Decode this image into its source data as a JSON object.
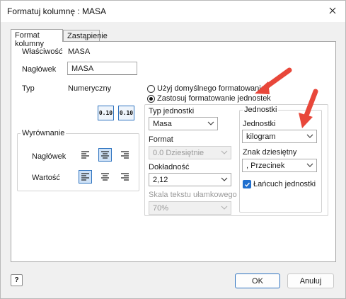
{
  "window": {
    "title": "Formatuj kolumnę : MASA"
  },
  "tabs": [
    {
      "label": "Format kolumny",
      "active": true
    },
    {
      "label": "Zastąpienie",
      "active": false
    }
  ],
  "properties": {
    "property_label": "Właściwość",
    "property_value": "MASA",
    "header_label": "Nagłówek",
    "header_value": "MASA",
    "type_label": "Typ",
    "type_value": "Numeryczny"
  },
  "format_buttons": [
    {
      "text": "0.10"
    },
    {
      "text": "0.10"
    }
  ],
  "alignment": {
    "group_title": "Wyrównanie",
    "header_label": "Nagłówek",
    "value_label": "Wartość",
    "header_selected": "center",
    "value_selected": "left"
  },
  "formatting": {
    "default_option": "Użyj domyślnego formatowania",
    "units_option": "Zastosuj formatowanie jednostek",
    "selected": "units"
  },
  "unit_settings": {
    "unit_type_label": "Typ jednostki",
    "unit_type_value": "Masa",
    "format_label": "Format",
    "format_value": "0.0 Dziesiętnie",
    "precision_label": "Dokładność",
    "precision_value": "2,12",
    "fraction_scale_label": "Skala tekstu ułamkowego",
    "fraction_scale_value": "70%"
  },
  "units_group": {
    "title": "Jednostki",
    "units_label": "Jednostki",
    "units_value": "kilogram",
    "decimal_label": "Znak dziesiętny",
    "decimal_value": ", Przecinek",
    "chain_label": "Łańcuch jednostki",
    "chain_checked": true
  },
  "footer": {
    "ok_label": "OK",
    "cancel_label": "Anuluj",
    "help_glyph": "?"
  },
  "colors": {
    "accent": "#2f74c0",
    "annotation_arrow": "#e8473a",
    "checkbox": "#1f6fcf"
  }
}
